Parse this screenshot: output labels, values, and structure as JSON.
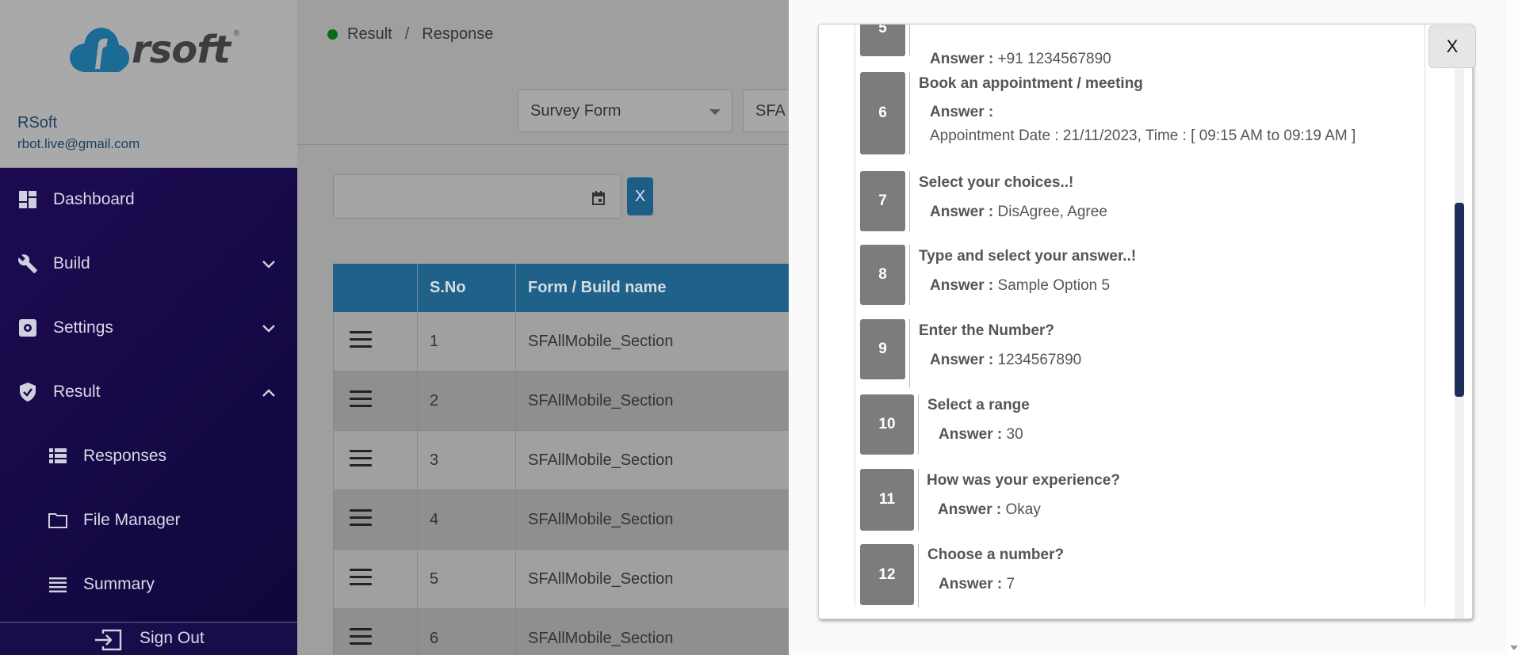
{
  "brand": {
    "name": "rsoft",
    "reg": "®"
  },
  "user": {
    "name": "RSoft",
    "email": "rbot.live@gmail.com"
  },
  "nav": {
    "dashboard": "Dashboard",
    "build": "Build",
    "settings": "Settings",
    "result": "Result",
    "responses": "Responses",
    "file_manager": "File Manager",
    "summary": "Summary",
    "sign_out": "Sign Out"
  },
  "breadcrumb": {
    "first": "Result",
    "sep": "/",
    "second": "Response"
  },
  "filters": {
    "form_type": "Survey Form",
    "form_name": "SFA"
  },
  "clear_button": "X",
  "table": {
    "headers": [
      "",
      "S.No",
      "Form / Build name"
    ],
    "rows": [
      {
        "sno": "1",
        "name": "SFAllMobile_Section"
      },
      {
        "sno": "2",
        "name": "SFAllMobile_Section"
      },
      {
        "sno": "3",
        "name": "SFAllMobile_Section"
      },
      {
        "sno": "4",
        "name": "SFAllMobile_Section"
      },
      {
        "sno": "5",
        "name": "SFAllMobile_Section"
      },
      {
        "sno": "6",
        "name": "SFAllMobile_Section"
      }
    ]
  },
  "drawer": {
    "close_label": "X",
    "answer_label": "Answer :",
    "questions": [
      {
        "num": "5",
        "question": "",
        "answer": "+91 1234567890"
      },
      {
        "num": "6",
        "question": "Book an appointment / meeting",
        "answer": "",
        "answer_line2": "Appointment Date : 21/11/2023, Time : [ 09:15 AM to 09:19 AM ]"
      },
      {
        "num": "7",
        "question": "Select your choices..!",
        "answer": "DisAgree, Agree"
      },
      {
        "num": "8",
        "question": "Type and select your answer..!",
        "answer": "Sample Option 5"
      },
      {
        "num": "9",
        "question": "Enter the Number?",
        "answer": "1234567890"
      },
      {
        "num": "10",
        "question": "Select a range",
        "answer": "30"
      },
      {
        "num": "11",
        "question": "How was your experience?",
        "answer": "Okay"
      },
      {
        "num": "12",
        "question": "Choose a number?",
        "answer": "7"
      }
    ]
  }
}
